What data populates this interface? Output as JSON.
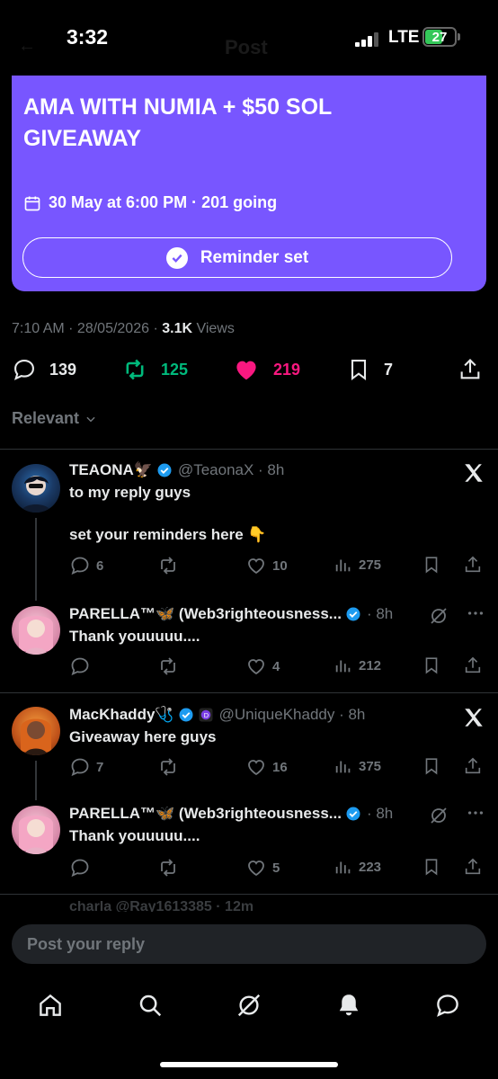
{
  "status_bar": {
    "time": "3:32",
    "network": "LTE",
    "battery": "27",
    "battery_level": 0.27
  },
  "header": {
    "title": "Post"
  },
  "event": {
    "title": "AMA WITH NUMIA + $50 SOL GIVEAWAY",
    "meta": "30 May at 6:00 PM · 201 going",
    "reminder_label": "Reminder set"
  },
  "post": {
    "time": "7:10 AM · 28/05/2026 · ",
    "views_count": "3.1K",
    "views_label": " Views",
    "replies": "139",
    "reposts": "125",
    "likes": "219",
    "bookmarks": "7"
  },
  "filter": {
    "label": "Relevant"
  },
  "replies": [
    {
      "name": "TEAONA🦅",
      "handle": "@TeaonaX · 8h",
      "text_line1": "to my reply guys",
      "text_line2": "set your reminders here 👇",
      "replies": "6",
      "likes": "10",
      "views": "275"
    },
    {
      "name": "PARELLA™🦋 (Web3righteousness...",
      "handle": "· 8h",
      "text_line1": "Thank youuuuu....",
      "replies": "",
      "likes": "4",
      "views": "212"
    },
    {
      "name": "MacKhaddy🩺",
      "handle": "@UniqueKhaddy · 8h",
      "text_line1": "Giveaway here guys",
      "replies": "7",
      "likes": "16",
      "views": "375"
    },
    {
      "name": "PARELLA™🦋 (Web3righteousness...",
      "handle": "· 8h",
      "text_line1": "Thank youuuuu....",
      "replies": "",
      "likes": "5",
      "views": "223"
    }
  ],
  "partial_reply": "charla @Ray1613385 · 12m",
  "reply_input": {
    "placeholder": "Post your reply"
  },
  "colors": {
    "accent": "#1d9bf0",
    "event_bg": "#7856ff",
    "repost": "#00ba7c",
    "like": "#f91880"
  }
}
